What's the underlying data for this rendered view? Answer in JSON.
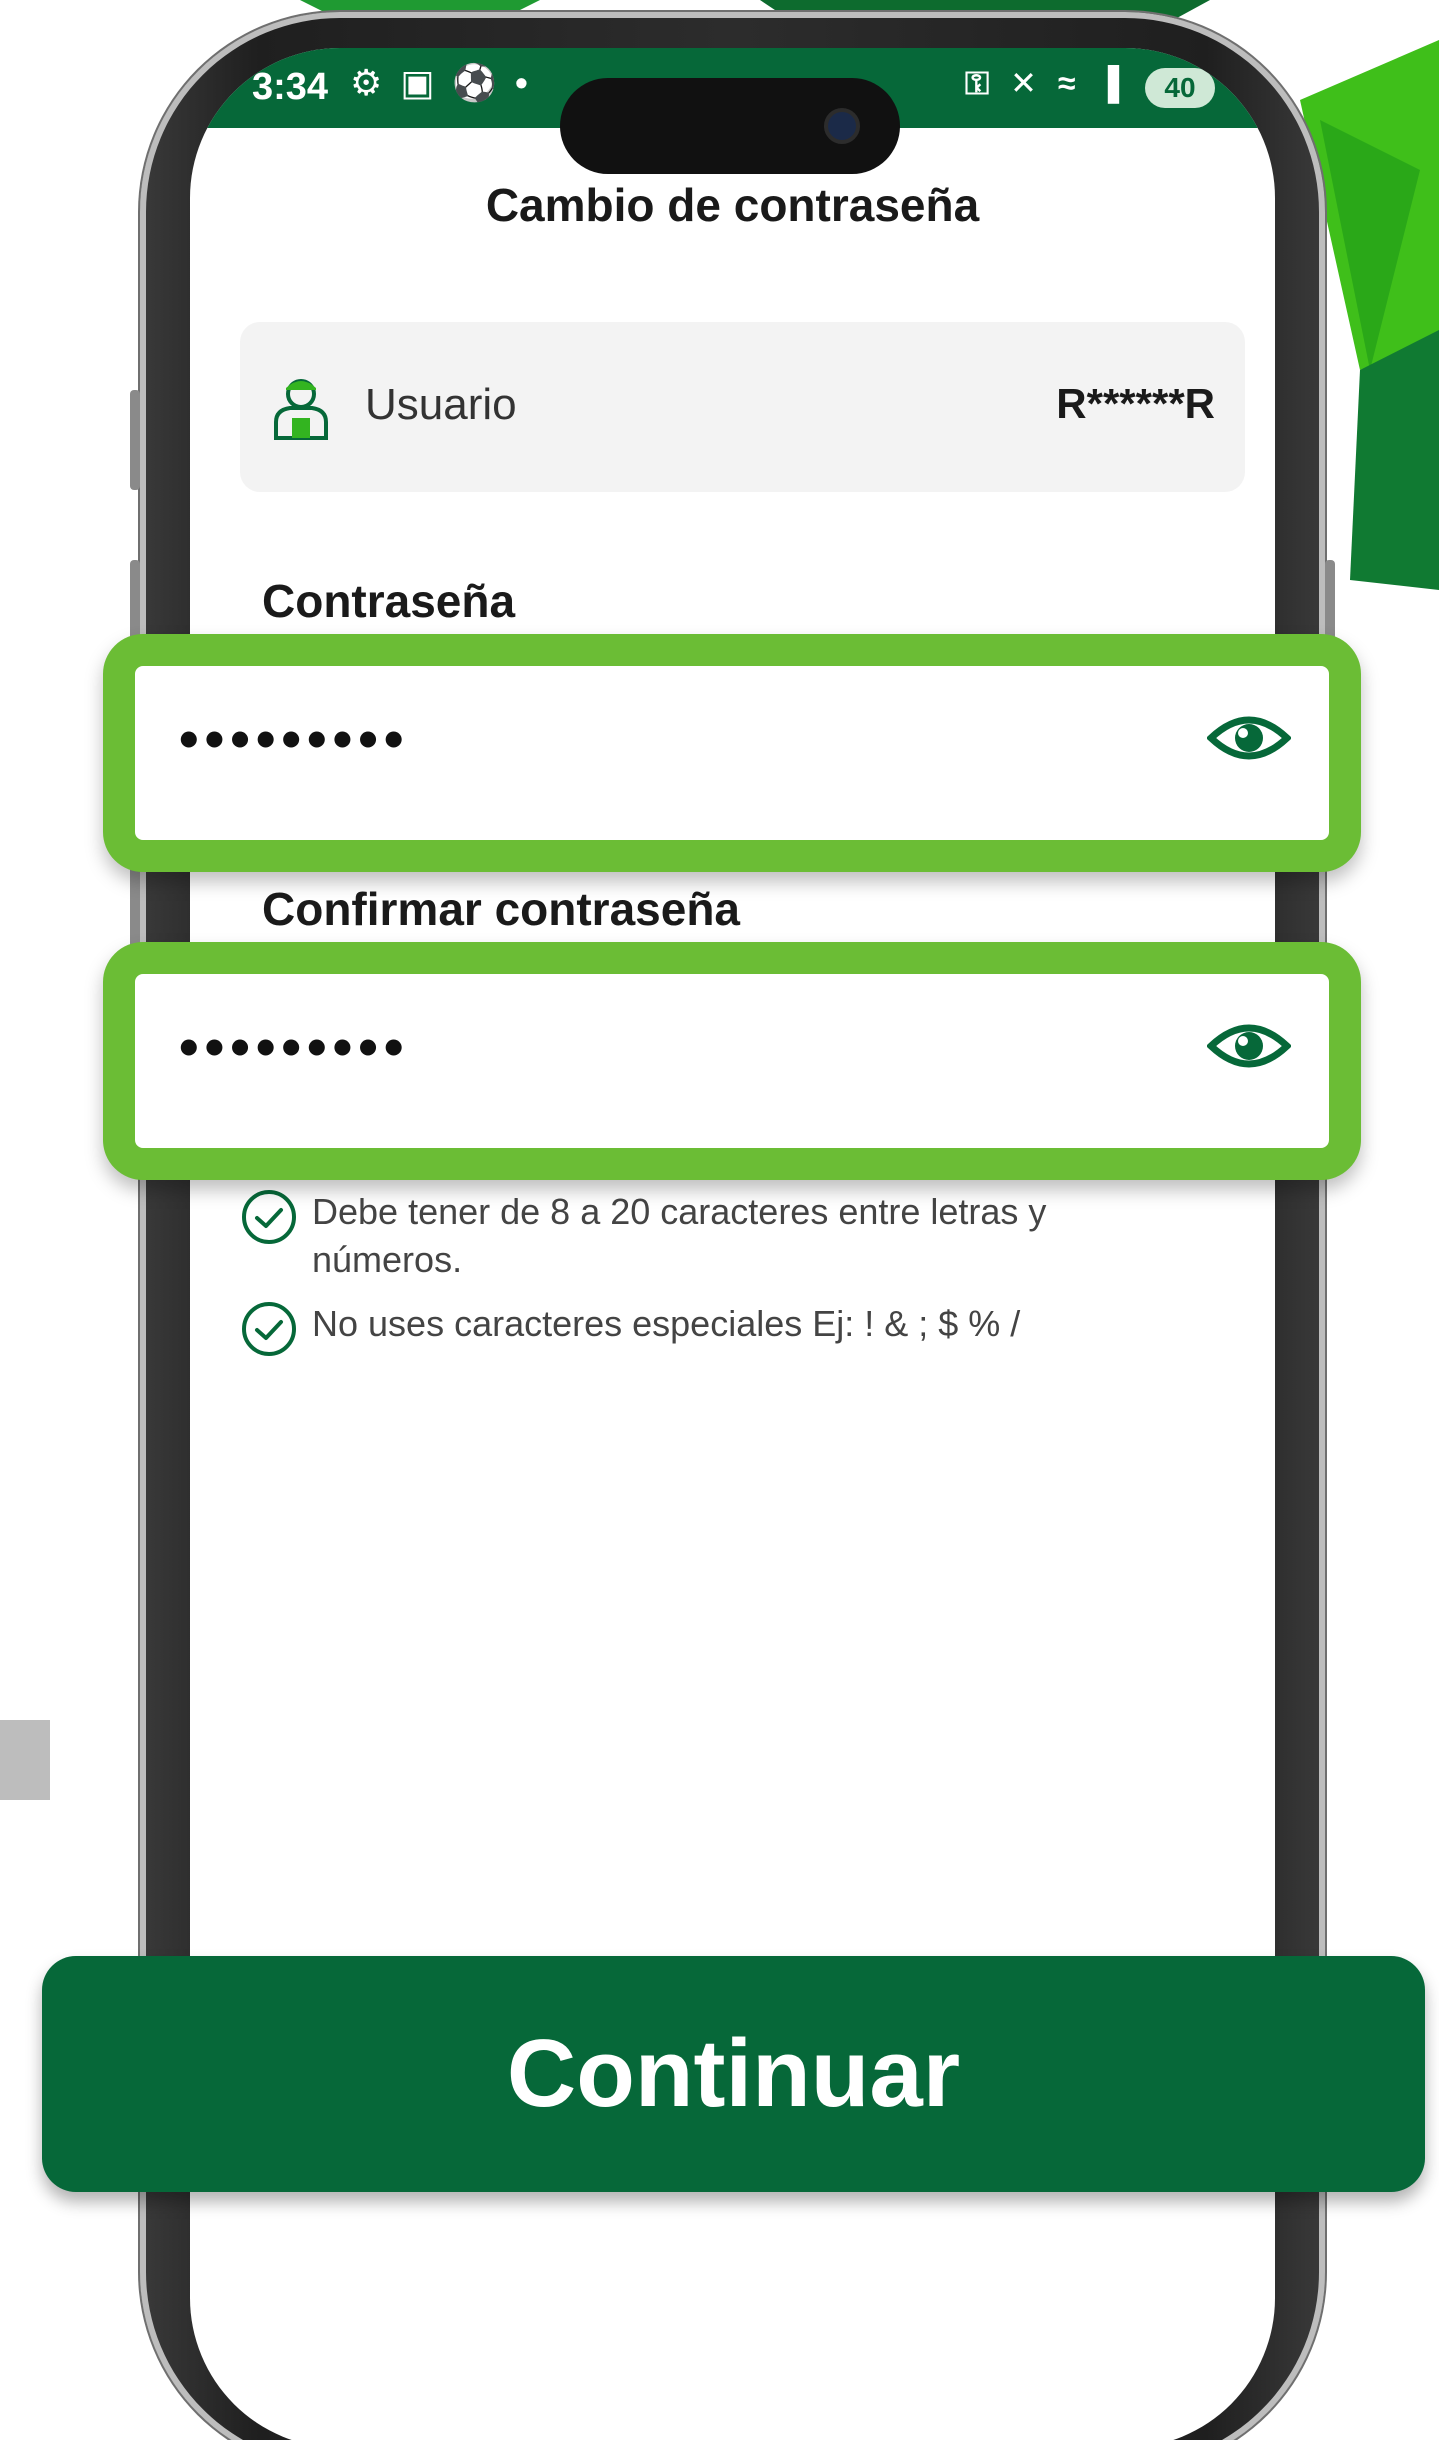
{
  "status_bar": {
    "time": "3:34",
    "left_icons": "⚙ ▣ ⚽ •",
    "right_icons": "⚿ ✕ ≈ ▐",
    "battery": "40"
  },
  "screen": {
    "title": "Cambio de contraseña"
  },
  "user": {
    "label": "Usuario",
    "value": "R******R",
    "icon": "user-icon"
  },
  "password": {
    "label": "Contraseña",
    "value": "•••••••••",
    "icon": "eye-icon"
  },
  "confirm_password": {
    "label": "Confirmar contraseña",
    "value": "•••••••••",
    "icon": "eye-icon"
  },
  "rules": [
    {
      "line1": "Debe tener de 8 a 20 caracteres entre letras y",
      "line2": "números.",
      "icon": "check-circle-icon"
    },
    {
      "line1": "No uses caracteres especiales Ej: ! & ; $ % /",
      "line2": "",
      "icon": "check-circle-icon"
    }
  ],
  "actions": {
    "continue_label": "Continuar"
  },
  "colors": {
    "brand_green": "#066839",
    "highlight_green": "#6bbd35",
    "accent_green": "#33b420"
  }
}
